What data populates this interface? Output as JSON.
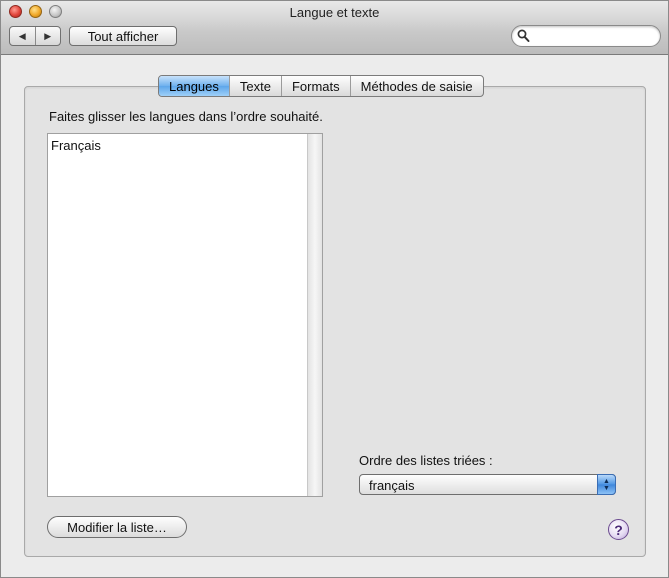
{
  "window": {
    "title": "Langue et texte"
  },
  "toolbar": {
    "back_glyph": "◀",
    "forward_glyph": "▶",
    "show_all_label": "Tout afficher",
    "search": {
      "value": "",
      "placeholder": ""
    }
  },
  "tabs": [
    {
      "label": "Langues",
      "active": true
    },
    {
      "label": "Texte",
      "active": false
    },
    {
      "label": "Formats",
      "active": false
    },
    {
      "label": "Méthodes de saisie",
      "active": false
    }
  ],
  "languages_pane": {
    "instruction": "Faites glisser les langues dans l’ordre souhaité.",
    "languages": [
      "Français"
    ],
    "sort_order_label": "Ordre des listes triées :",
    "sort_order_value": "français",
    "edit_list_label": "Modifier la liste…",
    "help_glyph": "?"
  },
  "colors": {
    "accent": "#5ea6ea",
    "help": "#4b2a78"
  }
}
